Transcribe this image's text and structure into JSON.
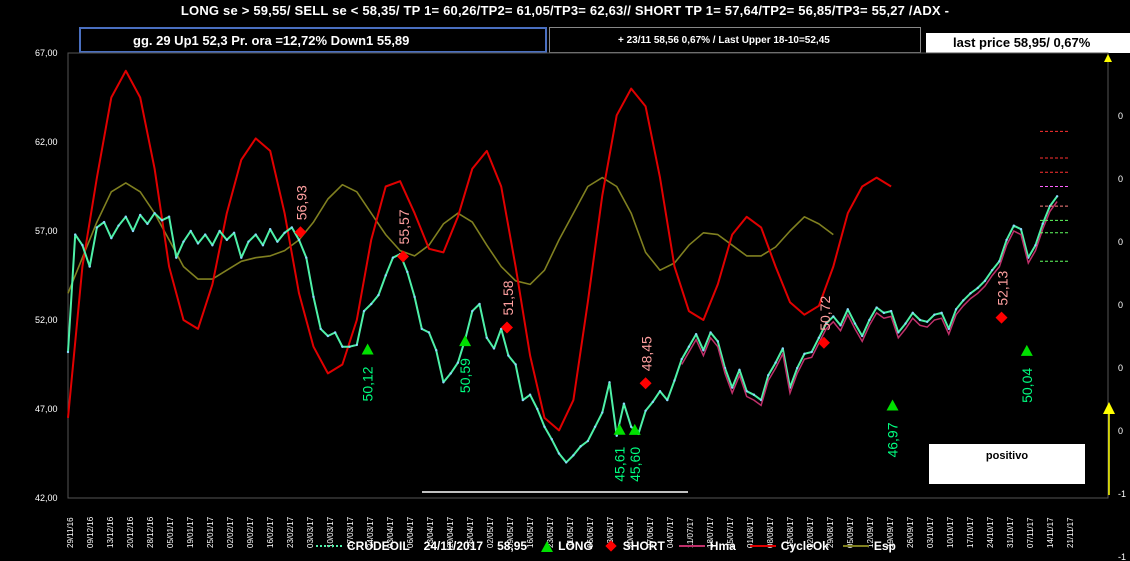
{
  "header": {
    "title": "LONG se > 59,55/   SELL se < 58,35/ TP 1= 60,26/TP2= 61,05/TP3= 62,63//    SHORT TP 1= 57,64/TP2= 56,85/TP3= 55,27 /ADX -",
    "stats": "gg. 29 Up1   52,3   Pr. ora =12,72%    Down1  55,89",
    "info": "+  23/11    58,56  0,67% / Last Upper 18-10=52,45",
    "last_price": "last price 58,95/  0,67%",
    "status": "positivo"
  },
  "legend": {
    "crude": "CRUDEOIL",
    "date": "24/11/2017",
    "price": "58,95",
    "long": "LONG",
    "short": "SHORT",
    "hma": "Hma",
    "cycle": "CycleOk",
    "esp": "Esp"
  },
  "colors": {
    "price": "#4ef0a8",
    "cycle": "#e00000",
    "esp": "#808020",
    "hma": "#c0306a",
    "long": "#00e000",
    "short": "#ff0000",
    "long_label": "#00ff80",
    "short_label": "#ffa0a0",
    "header_box": "#4a6fc0"
  },
  "chart_data": {
    "type": "line",
    "title": "",
    "ylim": [
      42,
      67
    ],
    "yticks": [
      "67,00",
      "62,00",
      "57,00",
      "52,00",
      "47,00",
      "42,00"
    ],
    "right_ticks": [
      "0",
      "0",
      "0",
      "0",
      "0",
      "0",
      "-1",
      "-1"
    ],
    "x_labels": [
      "29/11/16",
      "09/12/16",
      "13/12/16",
      "20/12/16",
      "28/12/16",
      "05/01/17",
      "19/01/17",
      "25/01/17",
      "02/02/17",
      "09/02/17",
      "16/02/17",
      "23/02/17",
      "03/03/17",
      "10/03/17",
      "17/03/17",
      "24/03/17",
      "03/04/17",
      "06/04/17",
      "13/04/17",
      "20/04/17",
      "25/04/17",
      "02/05/17",
      "09/05/17",
      "16/05/17",
      "23/05/17",
      "31/05/17",
      "06/06/17",
      "13/06/17",
      "20/06/17",
      "27/06/17",
      "04/07/17",
      "11/07/17",
      "18/07/17",
      "25/07/17",
      "01/08/17",
      "08/08/17",
      "15/08/17",
      "22/08/17",
      "29/08/17",
      "05/09/17",
      "12/09/17",
      "19/09/17",
      "26/09/17",
      "03/10/17",
      "10/10/17",
      "17/10/17",
      "24/10/17",
      "31/10/17",
      "07/11/17",
      "14/11/17",
      "21/11/17"
    ],
    "long_signals": [
      {
        "x": 0.415,
        "value": 50.12,
        "label": "50,12"
      },
      {
        "x": 0.55,
        "value": 50.59,
        "label": "50,59"
      },
      {
        "x": 0.764,
        "value": 45.61,
        "label": "45,61"
      },
      {
        "x": 0.785,
        "value": 45.6,
        "label": "45,60"
      },
      {
        "x": 1.142,
        "value": 46.97,
        "label": "46,97"
      },
      {
        "x": 1.328,
        "value": 50.04,
        "label": "50,04"
      }
    ],
    "short_signals": [
      {
        "x": 0.322,
        "value": 56.93,
        "label": "56,93"
      },
      {
        "x": 0.464,
        "value": 55.57,
        "label": "55,57"
      },
      {
        "x": 0.608,
        "value": 51.58,
        "label": "51,58"
      },
      {
        "x": 0.8,
        "value": 48.45,
        "label": "48,45"
      },
      {
        "x": 1.047,
        "value": 50.72,
        "label": "50,72"
      },
      {
        "x": 1.293,
        "value": 52.13,
        "label": "52,13"
      }
    ],
    "series": [
      {
        "name": "CRUDEOIL",
        "points": [
          [
            0,
            50.2
          ],
          [
            0.01,
            56.8
          ],
          [
            0.02,
            56.2
          ],
          [
            0.03,
            55.0
          ],
          [
            0.04,
            57.2
          ],
          [
            0.05,
            57.5
          ],
          [
            0.06,
            56.6
          ],
          [
            0.07,
            57.3
          ],
          [
            0.08,
            57.8
          ],
          [
            0.09,
            57.0
          ],
          [
            0.1,
            57.9
          ],
          [
            0.11,
            57.4
          ],
          [
            0.12,
            58.0
          ],
          [
            0.13,
            57.6
          ],
          [
            0.14,
            57.8
          ],
          [
            0.15,
            55.5
          ],
          [
            0.16,
            56.4
          ],
          [
            0.17,
            57.0
          ],
          [
            0.18,
            56.3
          ],
          [
            0.19,
            56.8
          ],
          [
            0.2,
            56.2
          ],
          [
            0.21,
            57.0
          ],
          [
            0.22,
            56.5
          ],
          [
            0.23,
            56.9
          ],
          [
            0.24,
            55.5
          ],
          [
            0.25,
            56.4
          ],
          [
            0.26,
            56.8
          ],
          [
            0.27,
            56.2
          ],
          [
            0.28,
            57.1
          ],
          [
            0.29,
            56.4
          ],
          [
            0.3,
            56.9
          ],
          [
            0.31,
            57.2
          ],
          [
            0.32,
            56.5
          ],
          [
            0.33,
            55.5
          ],
          [
            0.34,
            53.3
          ],
          [
            0.35,
            51.5
          ],
          [
            0.36,
            51.1
          ],
          [
            0.37,
            51.3
          ],
          [
            0.38,
            50.5
          ],
          [
            0.39,
            50.5
          ],
          [
            0.4,
            50.6
          ],
          [
            0.41,
            52.5
          ],
          [
            0.42,
            52.9
          ],
          [
            0.43,
            53.4
          ],
          [
            0.44,
            54.5
          ],
          [
            0.45,
            55.5
          ],
          [
            0.46,
            55.7
          ],
          [
            0.47,
            54.7
          ],
          [
            0.48,
            53.3
          ],
          [
            0.49,
            51.5
          ],
          [
            0.5,
            51.3
          ],
          [
            0.51,
            50.3
          ],
          [
            0.52,
            48.5
          ],
          [
            0.53,
            49.0
          ],
          [
            0.54,
            49.6
          ],
          [
            0.55,
            50.9
          ],
          [
            0.56,
            52.5
          ],
          [
            0.57,
            52.9
          ],
          [
            0.58,
            51.0
          ],
          [
            0.59,
            50.4
          ],
          [
            0.6,
            51.5
          ],
          [
            0.61,
            50.0
          ],
          [
            0.62,
            49.5
          ],
          [
            0.63,
            47.5
          ],
          [
            0.64,
            47.8
          ],
          [
            0.65,
            47.0
          ],
          [
            0.66,
            46.0
          ],
          [
            0.67,
            45.3
          ],
          [
            0.68,
            44.5
          ],
          [
            0.69,
            44.0
          ],
          [
            0.7,
            44.4
          ],
          [
            0.71,
            44.9
          ],
          [
            0.72,
            45.2
          ],
          [
            0.73,
            46.0
          ],
          [
            0.74,
            46.8
          ],
          [
            0.75,
            48.5
          ],
          [
            0.76,
            45.5
          ],
          [
            0.77,
            47.3
          ],
          [
            0.78,
            46.0
          ],
          [
            0.79,
            45.6
          ],
          [
            0.8,
            46.9
          ],
          [
            0.81,
            47.4
          ],
          [
            0.82,
            48.0
          ],
          [
            0.83,
            47.5
          ],
          [
            0.84,
            48.6
          ],
          [
            0.85,
            49.8
          ],
          [
            0.86,
            50.5
          ],
          [
            0.87,
            51.2
          ],
          [
            0.88,
            50.3
          ],
          [
            0.89,
            51.3
          ],
          [
            0.9,
            50.8
          ],
          [
            0.91,
            49.3
          ],
          [
            0.92,
            48.2
          ],
          [
            0.93,
            49.2
          ],
          [
            0.94,
            48.0
          ],
          [
            0.95,
            47.8
          ],
          [
            0.96,
            47.5
          ],
          [
            0.97,
            48.9
          ],
          [
            0.98,
            49.6
          ],
          [
            0.99,
            50.4
          ],
          [
            1.0,
            48.2
          ],
          [
            1.01,
            49.3
          ],
          [
            1.02,
            50.1
          ],
          [
            1.03,
            50.2
          ],
          [
            1.04,
            51.0
          ],
          [
            1.05,
            51.8
          ],
          [
            1.06,
            52.2
          ],
          [
            1.07,
            51.7
          ],
          [
            1.08,
            52.6
          ],
          [
            1.09,
            51.8
          ],
          [
            1.1,
            51.1
          ],
          [
            1.11,
            52.0
          ],
          [
            1.12,
            52.7
          ],
          [
            1.13,
            52.4
          ],
          [
            1.14,
            52.5
          ],
          [
            1.15,
            51.3
          ],
          [
            1.16,
            51.8
          ],
          [
            1.17,
            52.4
          ],
          [
            1.18,
            52.0
          ],
          [
            1.19,
            51.9
          ],
          [
            1.2,
            52.3
          ],
          [
            1.21,
            52.4
          ],
          [
            1.22,
            51.5
          ],
          [
            1.23,
            52.6
          ],
          [
            1.24,
            53.1
          ],
          [
            1.25,
            53.5
          ],
          [
            1.26,
            53.8
          ],
          [
            1.27,
            54.2
          ],
          [
            1.28,
            54.8
          ],
          [
            1.29,
            55.3
          ],
          [
            1.3,
            56.5
          ],
          [
            1.31,
            57.3
          ],
          [
            1.32,
            57.1
          ],
          [
            1.33,
            55.5
          ],
          [
            1.34,
            56.2
          ],
          [
            1.35,
            57.4
          ],
          [
            1.36,
            58.4
          ],
          [
            1.37,
            58.95
          ]
        ]
      },
      {
        "name": "CycleOk",
        "points": [
          [
            0,
            46.5
          ],
          [
            0.02,
            55
          ],
          [
            0.04,
            60
          ],
          [
            0.06,
            64.5
          ],
          [
            0.08,
            66
          ],
          [
            0.1,
            64.5
          ],
          [
            0.12,
            60.5
          ],
          [
            0.14,
            55
          ],
          [
            0.16,
            52
          ],
          [
            0.18,
            51.5
          ],
          [
            0.2,
            54
          ],
          [
            0.22,
            58
          ],
          [
            0.24,
            61
          ],
          [
            0.26,
            62.2
          ],
          [
            0.28,
            61.5
          ],
          [
            0.3,
            58
          ],
          [
            0.32,
            53.5
          ],
          [
            0.34,
            50.5
          ],
          [
            0.36,
            49
          ],
          [
            0.38,
            49.5
          ],
          [
            0.4,
            52
          ],
          [
            0.42,
            56.5
          ],
          [
            0.44,
            59.5
          ],
          [
            0.46,
            59.8
          ],
          [
            0.48,
            58
          ],
          [
            0.5,
            56
          ],
          [
            0.52,
            55.8
          ],
          [
            0.54,
            57.8
          ],
          [
            0.56,
            60.5
          ],
          [
            0.58,
            61.5
          ],
          [
            0.6,
            59.5
          ],
          [
            0.62,
            55
          ],
          [
            0.64,
            50
          ],
          [
            0.66,
            46.5
          ],
          [
            0.68,
            45.8
          ],
          [
            0.7,
            47.5
          ],
          [
            0.72,
            53
          ],
          [
            0.74,
            59
          ],
          [
            0.76,
            63.5
          ],
          [
            0.78,
            65
          ],
          [
            0.8,
            64
          ],
          [
            0.82,
            60
          ],
          [
            0.84,
            55
          ],
          [
            0.86,
            52.5
          ],
          [
            0.88,
            52
          ],
          [
            0.9,
            54
          ],
          [
            0.92,
            56.8
          ],
          [
            0.94,
            57.8
          ],
          [
            0.96,
            57.2
          ],
          [
            0.98,
            55
          ],
          [
            1.0,
            53
          ],
          [
            1.02,
            52.3
          ],
          [
            1.04,
            52.8
          ],
          [
            1.06,
            55
          ],
          [
            1.08,
            58
          ],
          [
            1.1,
            59.5
          ],
          [
            1.12,
            60
          ],
          [
            1.14,
            59.5
          ]
        ]
      },
      {
        "name": "Esp",
        "points": [
          [
            0,
            53.5
          ],
          [
            0.02,
            55.5
          ],
          [
            0.04,
            57.5
          ],
          [
            0.06,
            59.2
          ],
          [
            0.08,
            59.7
          ],
          [
            0.1,
            59.2
          ],
          [
            0.12,
            58
          ],
          [
            0.14,
            56.5
          ],
          [
            0.16,
            55
          ],
          [
            0.18,
            54.3
          ],
          [
            0.2,
            54.3
          ],
          [
            0.22,
            54.8
          ],
          [
            0.24,
            55.3
          ],
          [
            0.26,
            55.5
          ],
          [
            0.28,
            55.6
          ],
          [
            0.3,
            55.9
          ],
          [
            0.32,
            56.5
          ],
          [
            0.34,
            57.5
          ],
          [
            0.36,
            58.8
          ],
          [
            0.38,
            59.6
          ],
          [
            0.4,
            59.2
          ],
          [
            0.42,
            58
          ],
          [
            0.44,
            56.8
          ],
          [
            0.46,
            55.9
          ],
          [
            0.48,
            55.6
          ],
          [
            0.5,
            56.2
          ],
          [
            0.52,
            57.4
          ],
          [
            0.54,
            58
          ],
          [
            0.56,
            57.5
          ],
          [
            0.58,
            56.2
          ],
          [
            0.6,
            55
          ],
          [
            0.62,
            54.2
          ],
          [
            0.64,
            54
          ],
          [
            0.66,
            54.8
          ],
          [
            0.68,
            56.5
          ],
          [
            0.7,
            58
          ],
          [
            0.72,
            59.5
          ],
          [
            0.74,
            60
          ],
          [
            0.76,
            59.5
          ],
          [
            0.78,
            58
          ],
          [
            0.8,
            55.8
          ],
          [
            0.82,
            54.8
          ],
          [
            0.84,
            55.2
          ],
          [
            0.86,
            56.2
          ],
          [
            0.88,
            56.9
          ],
          [
            0.9,
            56.8
          ],
          [
            0.92,
            56.2
          ],
          [
            0.94,
            55.6
          ],
          [
            0.96,
            55.6
          ],
          [
            0.98,
            56.1
          ],
          [
            1.0,
            57
          ],
          [
            1.02,
            57.8
          ],
          [
            1.04,
            57.4
          ],
          [
            1.06,
            56.8
          ]
        ]
      }
    ]
  }
}
